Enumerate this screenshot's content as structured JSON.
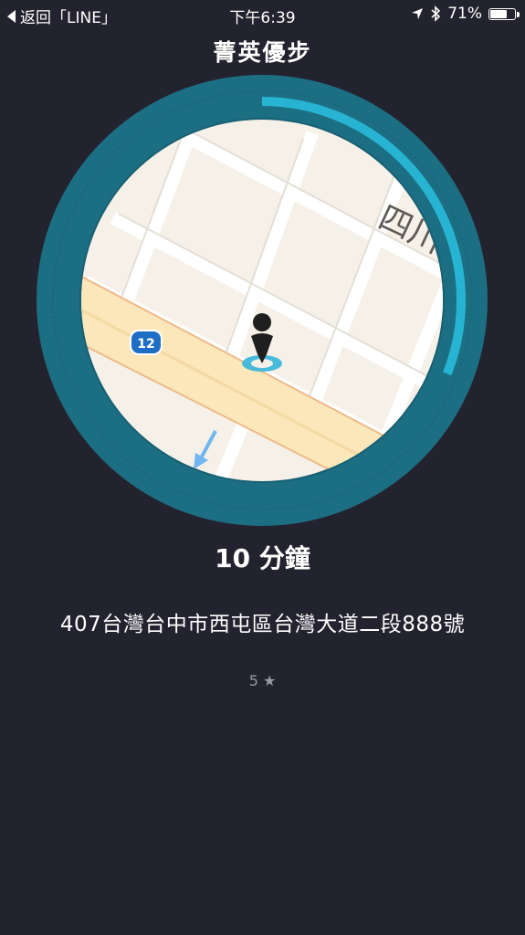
{
  "status_bar": {
    "back_label": "返回「LINE」",
    "time": "下午6:39",
    "battery_percent": "71%",
    "battery_level": 0.71
  },
  "title": "菁英優步",
  "map": {
    "road_labels": [
      "四川"
    ],
    "route_badge": "12"
  },
  "progress": {
    "fraction": 0.31
  },
  "timer": "10 分鐘",
  "address": "407台灣台中市西屯區台灣大道二段888號",
  "rating": "5 ★",
  "colors": {
    "background": "#23232f",
    "ring_track": "#1c6e83",
    "ring_progress": "#27b4d2",
    "map_land": "#f6f1e8",
    "map_road": "#ffffff",
    "map_highway": "#fbe7b9"
  }
}
